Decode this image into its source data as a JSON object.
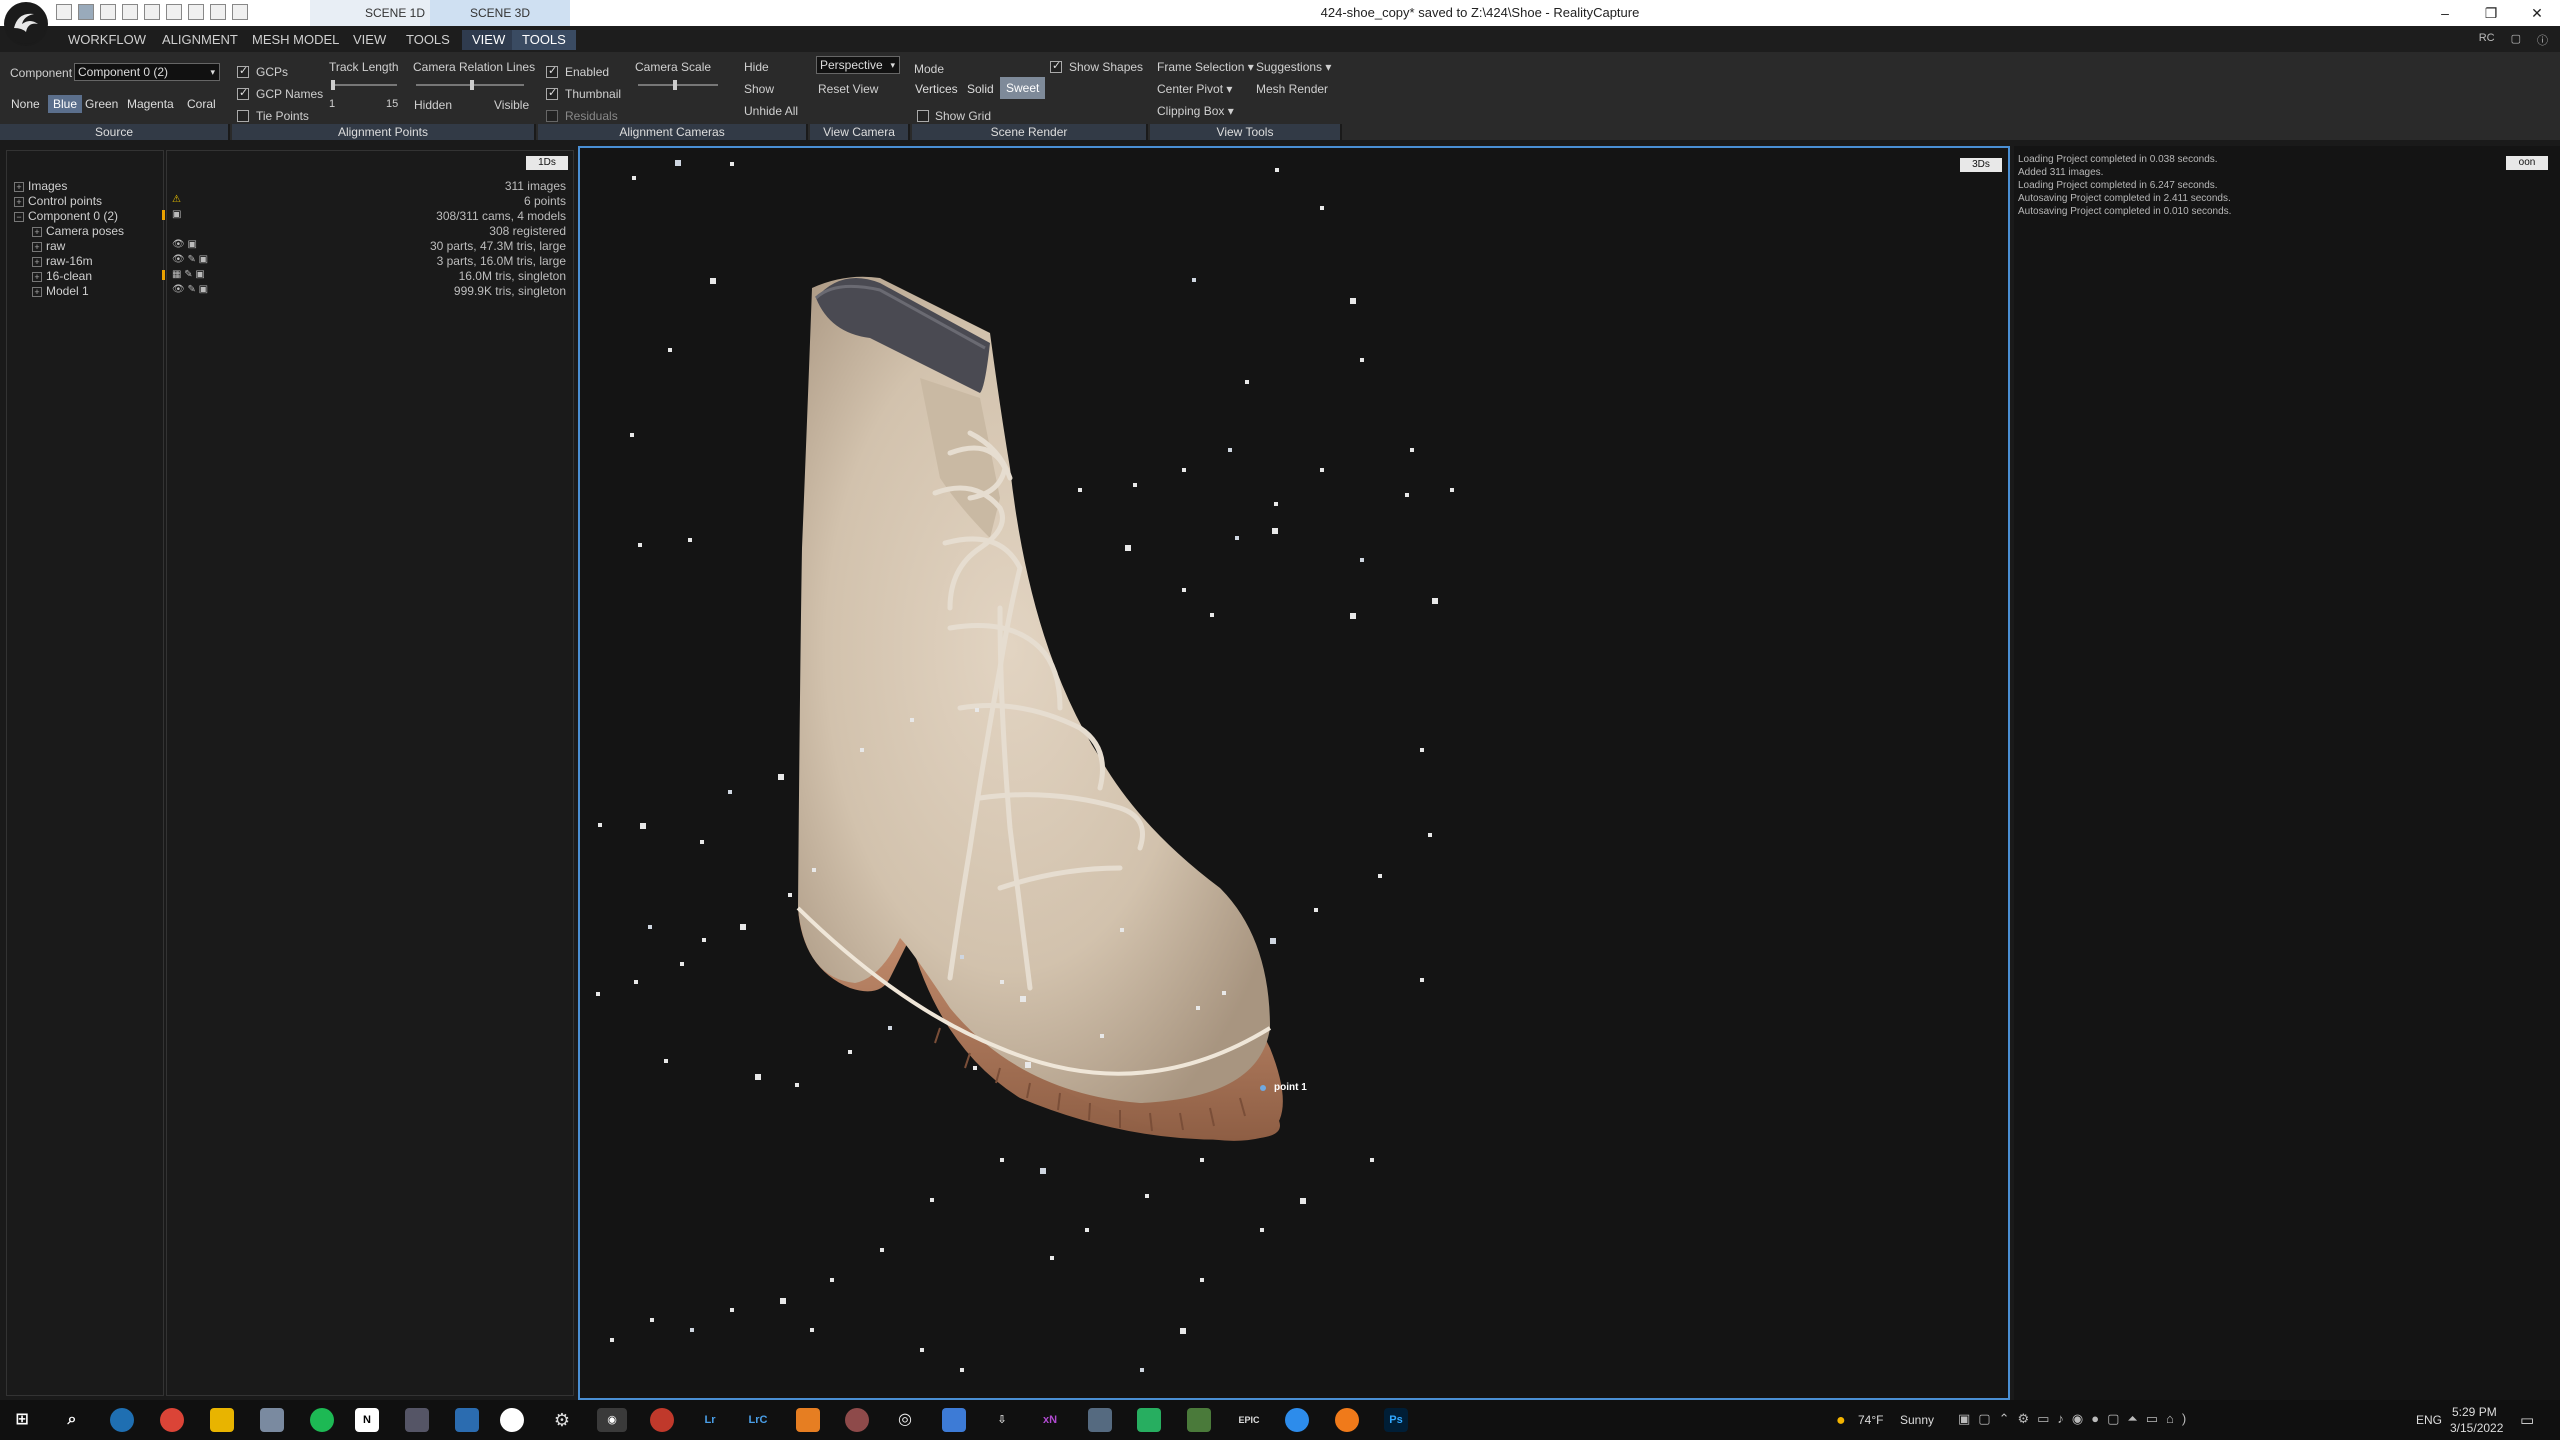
{
  "titlebar": {
    "scene_tabs": [
      "SCENE 1D",
      "SCENE 3D"
    ],
    "title": "424-shoe_copy* saved to Z:\\424\\Shoe - RealityCapture",
    "controls": [
      "–",
      "❐",
      "✕"
    ]
  },
  "menu": {
    "items": [
      "WORKFLOW",
      "ALIGNMENT",
      "MESH MODEL",
      "VIEW",
      "TOOLS",
      "VIEW",
      "TOOLS"
    ],
    "right": [
      "RC"
    ]
  },
  "ribbon": {
    "source": {
      "component_label": "Component",
      "component_value": "Component 0 (2)",
      "colors": [
        "None",
        "Blue",
        "Green",
        "Magenta",
        "Coral"
      ],
      "selected_color": "Blue",
      "group": "Source"
    },
    "alignment_points": {
      "gcps": "GCPs",
      "gcp_names": "GCP Names",
      "tie_points": "Tie Points",
      "track_length": "Track Length",
      "track_min": "1",
      "track_max": "15",
      "camera_relation_lines": "Camera Relation Lines",
      "hidden": "Hidden",
      "visible": "Visible",
      "group": "Alignment Points"
    },
    "alignment_cameras": {
      "enabled": "Enabled",
      "thumbnail": "Thumbnail",
      "residuals": "Residuals",
      "camera_scale": "Camera Scale",
      "group": "Alignment Cameras"
    },
    "view_camera": {
      "hide": "Hide",
      "show": "Show",
      "unhide_all": "Unhide All",
      "projection": "Perspective",
      "reset_view": "Reset View",
      "group": "View Camera"
    },
    "scene_render": {
      "mode": "Mode",
      "vertices": "Vertices",
      "solid": "Solid",
      "sweet": "Sweet",
      "show_grid": "Show Grid",
      "show_shapes": "Show Shapes",
      "group": "Scene Render"
    },
    "view_tools": {
      "frame_selection": "Frame Selection",
      "suggestions": "Suggestions",
      "center_pivot": "Center Pivot",
      "mesh_render": "Mesh Render",
      "clipping_box": "Clipping Box",
      "group": "View Tools"
    }
  },
  "tree": {
    "items": [
      {
        "label": "Images",
        "info": "311 images",
        "expander": "+"
      },
      {
        "label": "Control points",
        "info": "6 points",
        "expander": "+"
      },
      {
        "label": "Component 0 (2)",
        "info": "308/311 cams, 4 models",
        "expander": "−"
      },
      {
        "label": "Camera poses",
        "info": "308 registered",
        "expander": "+"
      },
      {
        "label": "raw",
        "info": "30 parts, 47.3M tris, large",
        "expander": "+"
      },
      {
        "label": "raw-16m",
        "info": "3 parts, 16.0M tris, large",
        "expander": "+"
      },
      {
        "label": "16-clean",
        "info": "16.0M tris, singleton",
        "expander": "+"
      },
      {
        "label": "Model 1",
        "info": "999.9K tris, singleton",
        "expander": "+"
      }
    ],
    "pill": "1Ds"
  },
  "viewport": {
    "pill": "3Ds",
    "point_label": "point 1"
  },
  "log": {
    "pill": "oon",
    "lines": [
      "Loading Project completed in 0.038 seconds.",
      "Added 311 images.",
      "Loading Project completed in 6.247 seconds.",
      "Autosaving Project completed in 2.411 seconds.",
      "Autosaving Project completed in 0.010 seconds."
    ]
  },
  "taskbar": {
    "weather_temp": "74°F",
    "weather_text": "Sunny",
    "lang": "ENG",
    "time": "5:29 PM",
    "date": "3/15/2022",
    "apps": [
      "Lr",
      "LrC",
      "xN",
      "Ps"
    ]
  },
  "colors": {
    "accent": "#4a8fd4",
    "shoe": "#d6c7b3",
    "sole": "#b07c5c"
  }
}
